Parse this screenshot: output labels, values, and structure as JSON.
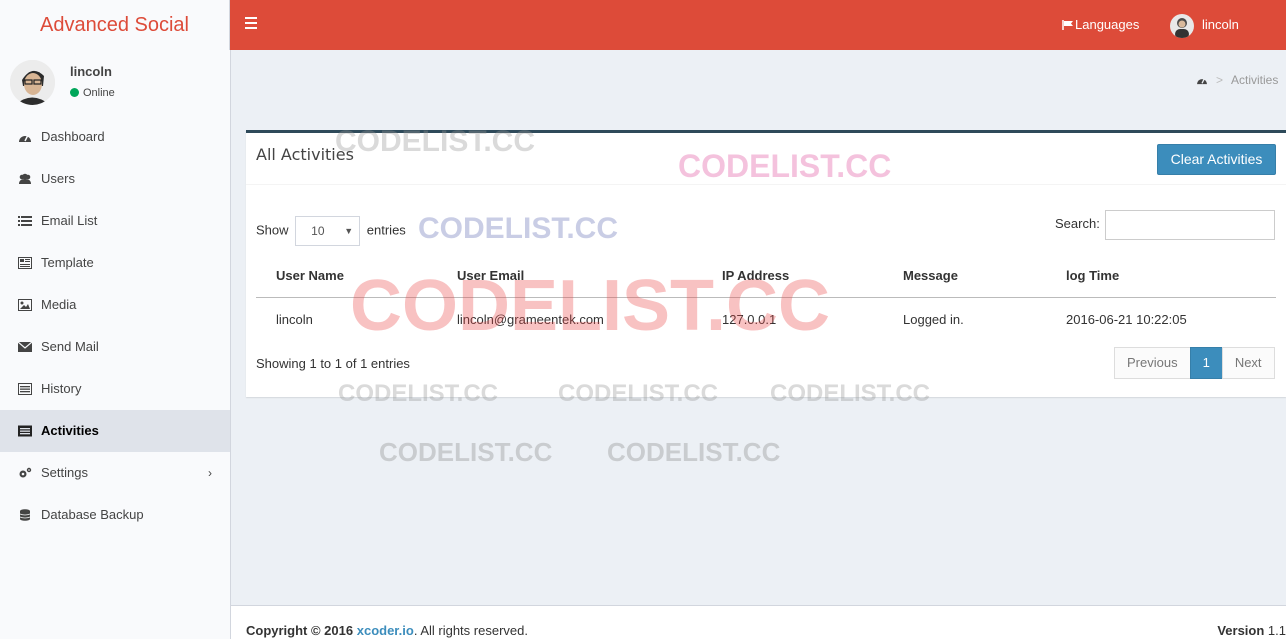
{
  "app": {
    "brand": "Advanced Social"
  },
  "header": {
    "languages_label": "Languages",
    "user_name": "lincoln"
  },
  "sidebar": {
    "user": {
      "name": "lincoln",
      "status": "Online"
    },
    "items": [
      {
        "label": "Dashboard",
        "icon": "dashboard-icon"
      },
      {
        "label": "Users",
        "icon": "users-icon"
      },
      {
        "label": "Email List",
        "icon": "list-icon"
      },
      {
        "label": "Template",
        "icon": "template-icon"
      },
      {
        "label": "Media",
        "icon": "image-icon"
      },
      {
        "label": "Send Mail",
        "icon": "envelope-icon"
      },
      {
        "label": "History",
        "icon": "history-icon"
      },
      {
        "label": "Activities",
        "icon": "activities-icon",
        "active": true
      },
      {
        "label": "Settings",
        "icon": "gears-icon",
        "chevron": "›"
      },
      {
        "label": "Database Backup",
        "icon": "database-icon"
      }
    ]
  },
  "breadcrumb": {
    "current": "Activities"
  },
  "box": {
    "title": "All Activities",
    "clear_button": "Clear Activities",
    "show_label": "Show",
    "entries_value": "10",
    "entries_label": "entries",
    "search_label": "Search:",
    "search_value": "",
    "columns": [
      "User Name",
      "User Email",
      "IP Address",
      "Message",
      "log Time"
    ],
    "rows": [
      [
        "lincoln",
        "lincoln@grameentek.com",
        "127.0.0.1",
        "Logged in.",
        "2016-06-21 10:22:05"
      ]
    ],
    "info": "Showing 1 to 1 of 1 entries",
    "pager": {
      "previous": "Previous",
      "page": "1",
      "next": "Next"
    }
  },
  "footer": {
    "copyright": "Copyright © 2016",
    "link": "xcoder.io",
    "rights": ". All rights reserved.",
    "version_label": "Version",
    "version": "1.1"
  },
  "watermark": {
    "text": "CODELIST.CC"
  },
  "colors": {
    "header": "#dd4b39",
    "primary": "#3c8dbc",
    "sidebar": "#f9fafc",
    "content": "#ecf0f5"
  }
}
